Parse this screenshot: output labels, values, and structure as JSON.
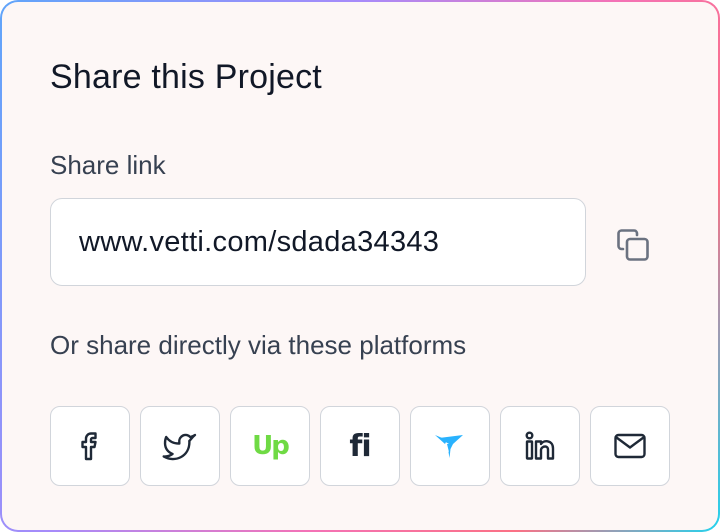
{
  "title": "Share this Project",
  "share_link": {
    "label": "Share link",
    "value": "www.vetti.com/sdada34343",
    "copy_icon": "copy-icon"
  },
  "platforms_label": "Or share directly via these platforms",
  "platforms": [
    {
      "name": "Facebook",
      "icon": "facebook-icon"
    },
    {
      "name": "Twitter",
      "icon": "twitter-icon"
    },
    {
      "name": "Upwork",
      "icon": "upwork-icon",
      "glyph": "Up",
      "color": "#6fda44"
    },
    {
      "name": "Fiverr",
      "icon": "fiverr-icon",
      "glyph": "fi"
    },
    {
      "name": "Freelancer",
      "icon": "freelancer-icon",
      "color": "#29b2fe"
    },
    {
      "name": "LinkedIn",
      "icon": "linkedin-icon"
    },
    {
      "name": "Email",
      "icon": "mail-icon"
    }
  ],
  "colors": {
    "card_background": "#fdf7f6",
    "text_primary": "#111827",
    "text_secondary": "#374151",
    "border": "#d1d5db",
    "icon": "#1f2937",
    "upwork": "#6fda44",
    "freelancer": "#29b2fe"
  }
}
